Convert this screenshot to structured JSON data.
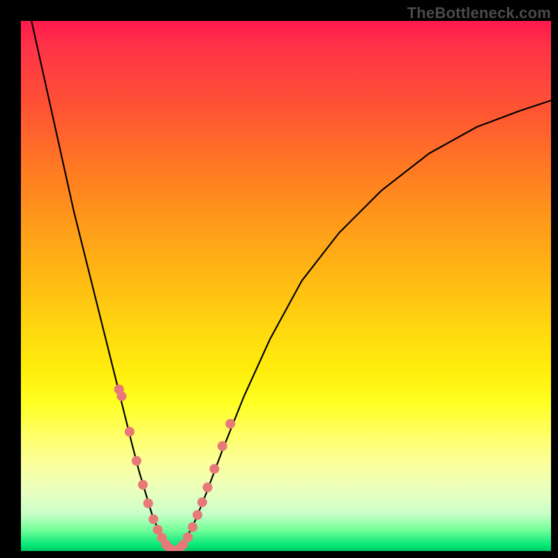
{
  "watermark": "TheBottleneck.com",
  "colors": {
    "gradient_top": "#ff1a4d",
    "gradient_bottom": "#00c864",
    "curve": "#000000",
    "dots": "#e77a78",
    "frame": "#000000"
  },
  "chart_data": {
    "type": "line",
    "title": "",
    "xlabel": "",
    "ylabel": "",
    "xlim": [
      0,
      100
    ],
    "ylim": [
      0,
      100
    ],
    "grid": false,
    "legend": false,
    "series": [
      {
        "name": "curve-left",
        "x": [
          2,
          4,
          6,
          8,
          10,
          12,
          14,
          16,
          18,
          19.5,
          21,
          22.3,
          23.5,
          25,
          26.5,
          28,
          29
        ],
        "y": [
          100,
          91,
          82,
          73,
          64,
          56,
          48,
          40,
          32,
          26,
          20,
          15,
          11,
          6,
          3,
          1,
          0
        ]
      },
      {
        "name": "curve-right",
        "x": [
          29,
          30,
          31.5,
          33,
          35,
          38,
          42,
          47,
          53,
          60,
          68,
          77,
          86,
          94,
          100
        ],
        "y": [
          0,
          1,
          3,
          6,
          11,
          19,
          29,
          40,
          51,
          60,
          68,
          75,
          80,
          83,
          85
        ]
      }
    ],
    "highlight_points": {
      "name": "salmon-dots",
      "x": [
        18.5,
        19.0,
        20.5,
        21.8,
        23.0,
        24.0,
        25.0,
        25.8,
        26.6,
        27.4,
        28.2,
        29.0,
        29.8,
        30.6,
        31.5,
        32.4,
        33.3,
        34.2,
        35.2,
        36.5,
        38.0,
        39.5
      ],
      "y": [
        30.5,
        29.2,
        22.5,
        17.0,
        12.5,
        9.0,
        6.0,
        4.0,
        2.5,
        1.2,
        0.4,
        0.0,
        0.4,
        1.2,
        2.6,
        4.5,
        6.8,
        9.2,
        12.0,
        15.5,
        19.8,
        24.0
      ]
    }
  }
}
